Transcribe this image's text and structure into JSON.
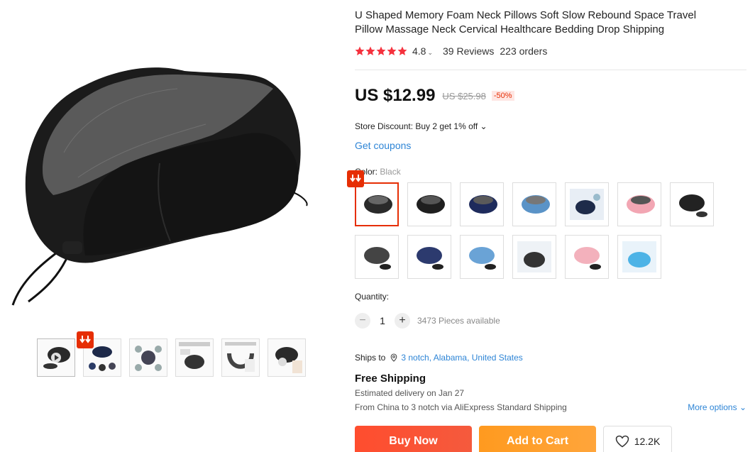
{
  "product": {
    "title": "U Shaped Memory Foam Neck Pillows Soft Slow Rebound Space Travel Pillow Massage Neck Cervical Healthcare Bedding Drop Shipping",
    "rating": "4.8",
    "rating_chevron": "⌄",
    "reviews": "39 Reviews",
    "orders": "223 orders",
    "star_color": "#f5323e"
  },
  "price": {
    "current": "US $12.99",
    "original": "US $25.98",
    "discount": "-50%"
  },
  "store_discount": "Store Discount: Buy 2 get 1% off ⌄",
  "coupons": "Get coupons",
  "color": {
    "label": "Color: ",
    "value": "Black",
    "swatch_count": 13,
    "selected_index": 0
  },
  "quantity": {
    "label": "Quantity:",
    "minus": "−",
    "value": "1",
    "plus": "+",
    "available": "3473 Pieces available"
  },
  "shipping": {
    "ships_to_label": "Ships to",
    "location": "3 notch, Alabama, United States",
    "free": "Free Shipping",
    "estimated": "Estimated delivery on Jan 27",
    "from": "From China to 3 notch via AliExpress Standard Shipping",
    "more_options": "More options ⌄"
  },
  "actions": {
    "buy_now": "Buy Now",
    "add_to_cart": "Add to Cart",
    "wishlist_count": "12.2K"
  },
  "colors": {
    "accent": "#e62e04",
    "link": "#2e85d6",
    "buy": "#f5452a",
    "cart": "#ff9e2c"
  }
}
